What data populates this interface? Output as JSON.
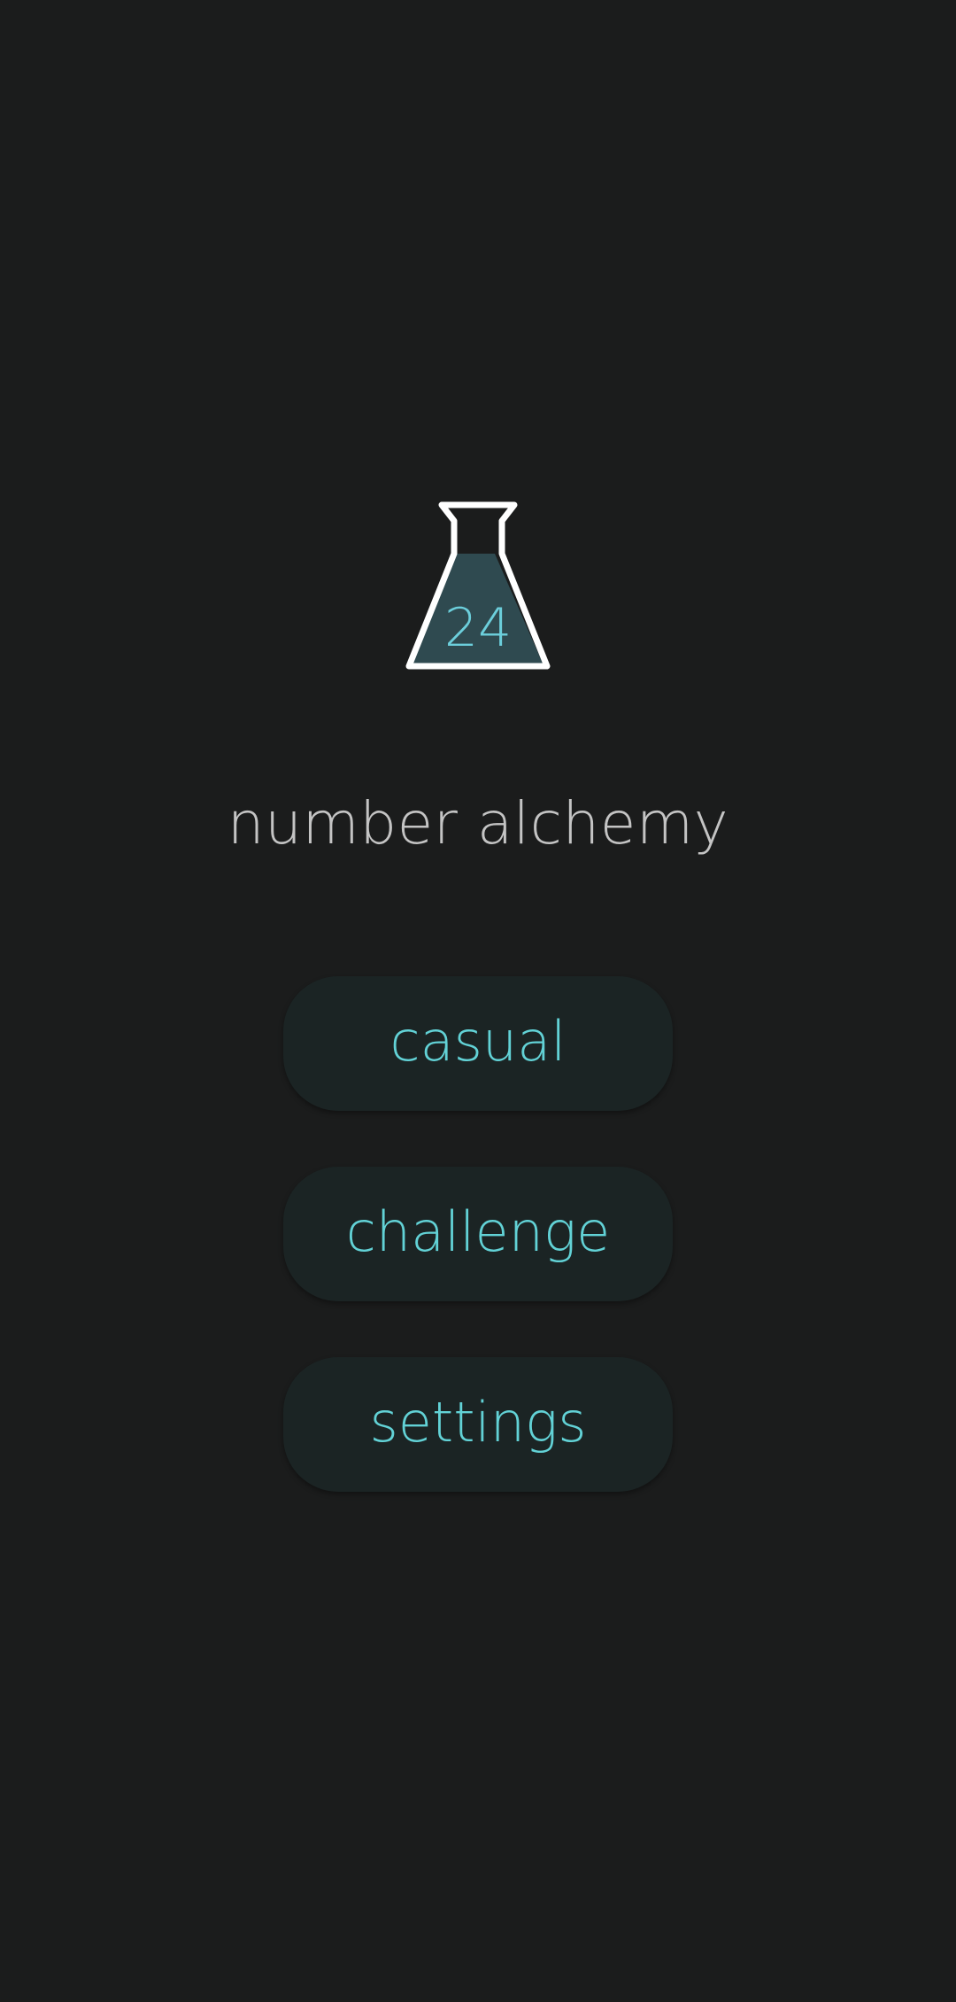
{
  "logo": {
    "flask_label": "24",
    "label_color": "#6ccfdc",
    "liquid_color": "#2f4a50",
    "outline_color": "#ffffff"
  },
  "title": "number alchemy",
  "menu": {
    "items": [
      {
        "label": "casual"
      },
      {
        "label": "challenge"
      },
      {
        "label": "settings"
      }
    ],
    "text_color": "#62d2d6",
    "button_color": "#1b2424"
  },
  "colors": {
    "background": "#1b1c1c",
    "title": "#c4c4c4"
  }
}
